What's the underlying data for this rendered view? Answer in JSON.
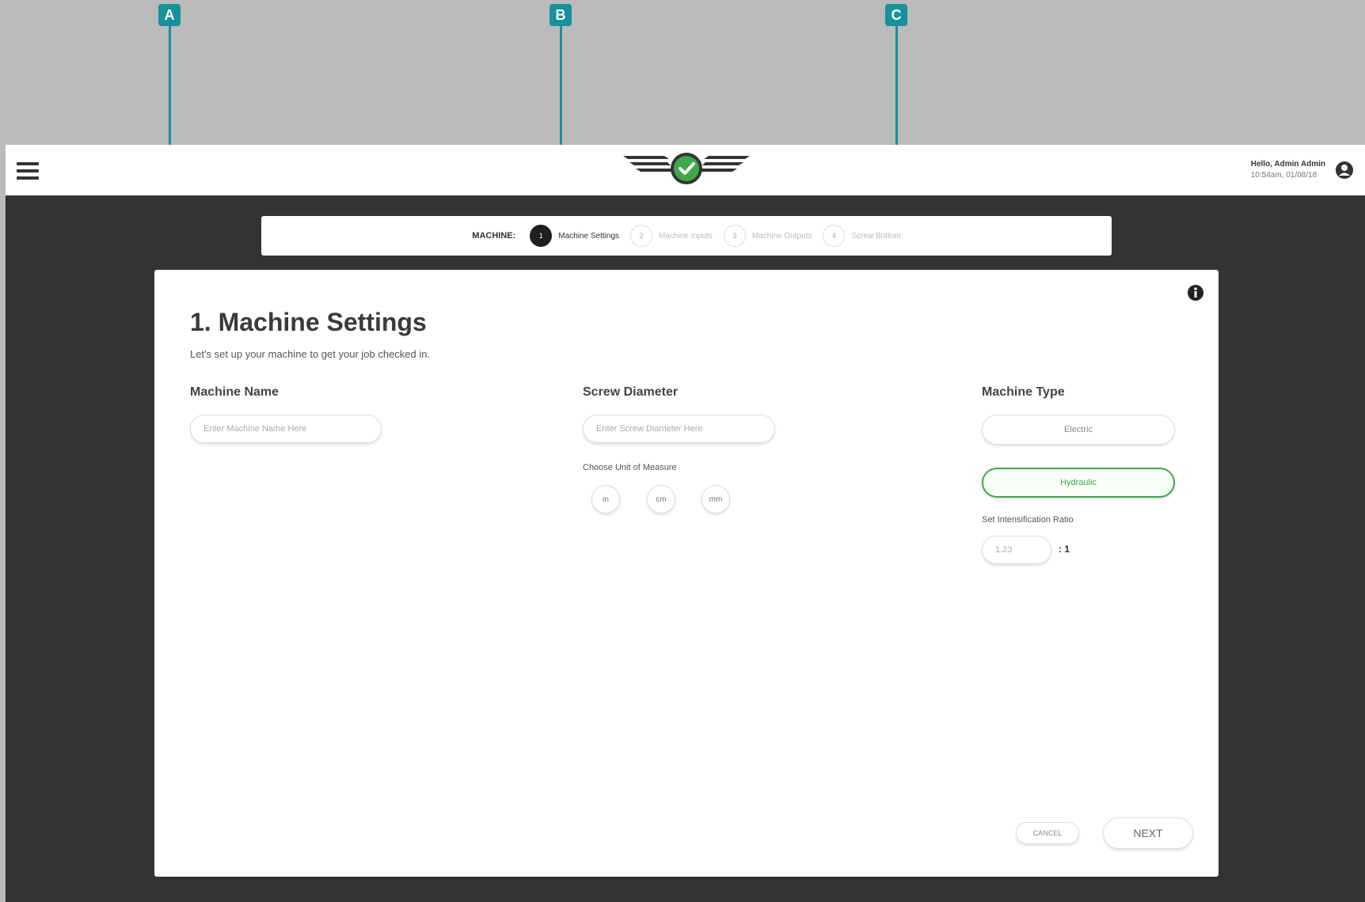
{
  "header": {
    "greeting": "Hello, Admin Admin",
    "datetime": "10:54am, 01/08/18",
    "menu_icon": "hamburger-icon",
    "user_icon": "account-circle-icon"
  },
  "stepper": {
    "label": "MACHINE:",
    "steps": [
      {
        "num": "1",
        "name": "Machine Settings"
      },
      {
        "num": "2",
        "name": "Machine Inputs"
      },
      {
        "num": "3",
        "name": "Machine Outputs"
      },
      {
        "num": "4",
        "name": "Screw Bottom"
      }
    ]
  },
  "page": {
    "title": "1. Machine Settings",
    "subtitle": "Let's set up your machine to get your job checked in."
  },
  "machine_name": {
    "label": "Machine Name",
    "placeholder": "Enter Machine Name Here"
  },
  "screw_diameter": {
    "label": "Screw Diameter",
    "placeholder": "Enter Screw Diameter Here",
    "unit_label": "Choose Unit of Measure",
    "units": [
      "in",
      "cm",
      "mm"
    ]
  },
  "machine_type": {
    "label": "Machine Type",
    "options": [
      "Electric",
      "Hydraulic"
    ],
    "selected": "Hydraulic",
    "ratio_label": "Set Intensification Ratio",
    "ratio_placeholder": "1.23",
    "ratio_suffix": ": 1"
  },
  "actions": {
    "cancel": "CANCEL",
    "next": "NEXT"
  },
  "callouts": [
    "A",
    "B",
    "C"
  ],
  "colors": {
    "accent": "#17919b",
    "selected": "#3fa84b",
    "background": "#333333"
  }
}
